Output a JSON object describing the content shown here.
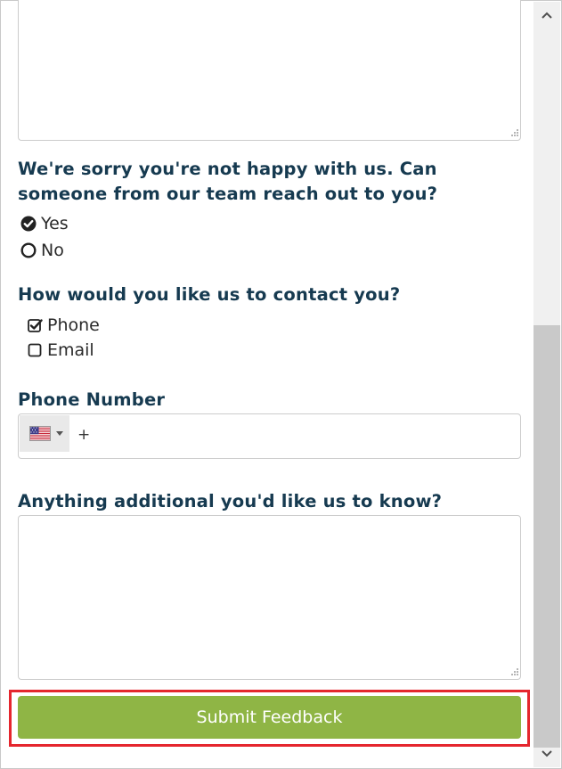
{
  "form": {
    "contact_question": "We're sorry you're not happy with us. Can someone from our team reach out to you?",
    "contact_options": [
      {
        "label": "Yes",
        "selected": true
      },
      {
        "label": "No",
        "selected": false
      }
    ],
    "method_question": "How would you like us to contact you?",
    "method_options": [
      {
        "label": "Phone",
        "checked": true
      },
      {
        "label": "Email",
        "checked": false
      }
    ],
    "phone_label": "Phone Number",
    "phone_country_flag": "us-flag-icon",
    "phone_prefix": "+",
    "additional_label": "Anything additional you'd like us to know?",
    "submit_label": "Submit Feedback"
  },
  "colors": {
    "heading": "#163a50",
    "submit_bg": "#8fb545",
    "highlight_border": "#e5262e"
  }
}
